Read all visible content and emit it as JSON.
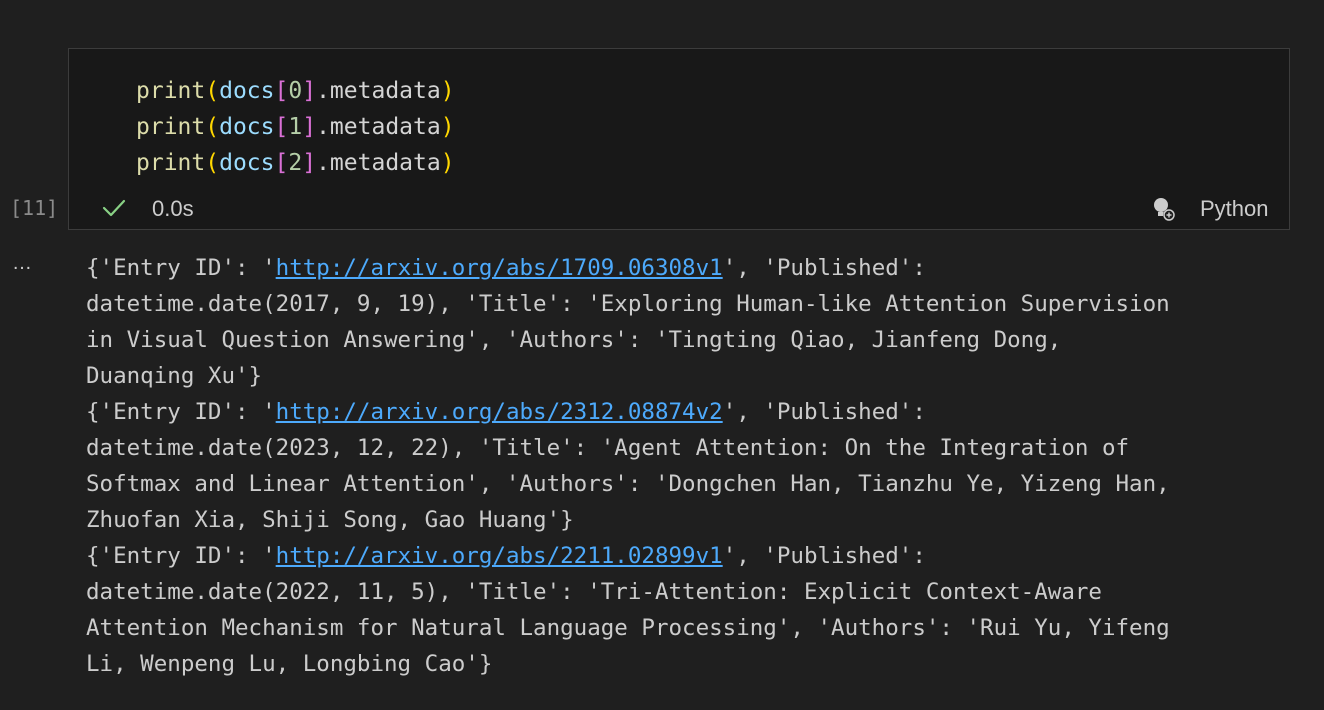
{
  "cell": {
    "execution_count": "[11]",
    "status_time": "0.0s",
    "kernel_language": "Python",
    "code_lines": [
      {
        "fn": "print",
        "var": "docs",
        "index": "0",
        "attr": ".metadata"
      },
      {
        "fn": "print",
        "var": "docs",
        "index": "1",
        "attr": ".metadata"
      },
      {
        "fn": "print",
        "var": "docs",
        "index": "2",
        "attr": ".metadata"
      }
    ]
  },
  "output": {
    "more_label": "…",
    "lines": [
      {
        "pre": "{'Entry ID': '",
        "link": "http://arxiv.org/abs/1709.06308v1",
        "post": "', 'Published':"
      },
      {
        "text": "datetime.date(2017, 9, 19), 'Title': 'Exploring Human-like Attention Supervision"
      },
      {
        "text": "in Visual Question Answering', 'Authors': 'Tingting Qiao, Jianfeng Dong,"
      },
      {
        "text": "Duanqing Xu'}"
      },
      {
        "pre": "{'Entry ID': '",
        "link": "http://arxiv.org/abs/2312.08874v2",
        "post": "', 'Published':"
      },
      {
        "text": "datetime.date(2023, 12, 22), 'Title': 'Agent Attention: On the Integration of"
      },
      {
        "text": "Softmax and Linear Attention', 'Authors': 'Dongchen Han, Tianzhu Ye, Yizeng Han,"
      },
      {
        "text": "Zhuofan Xia, Shiji Song, Gao Huang'}"
      },
      {
        "pre": "{'Entry ID': '",
        "link": "http://arxiv.org/abs/2211.02899v1",
        "post": "', 'Published':"
      },
      {
        "text": "datetime.date(2022, 11, 5), 'Title': 'Tri-Attention: Explicit Context-Aware"
      },
      {
        "text": "Attention Mechanism for Natural Language Processing', 'Authors': 'Rui Yu, Yifeng"
      },
      {
        "text": "Li, Wenpeng Lu, Longbing Cao'}"
      }
    ]
  },
  "colors": {
    "background": "#1f1f1f",
    "cell_background": "#181818",
    "success": "#89d185",
    "link": "#4daafc"
  }
}
